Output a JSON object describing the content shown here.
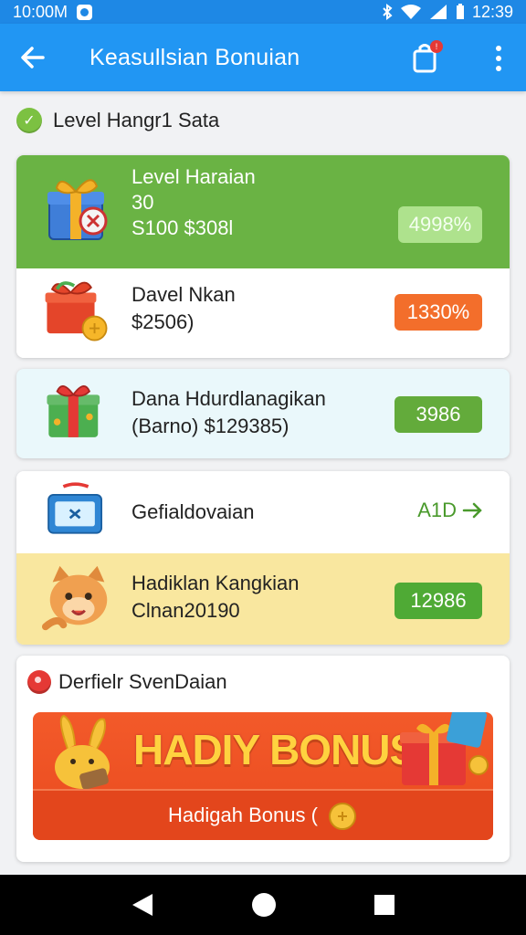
{
  "status_bar": {
    "time": "10:00M",
    "clock": "12:39"
  },
  "app_bar": {
    "title": "Keasullsian Bonuian",
    "cart_badge": "!"
  },
  "section": {
    "title": "Level Hangr1 Sata"
  },
  "cards": {
    "level": {
      "title": "Level Haraian",
      "subtitle": "30",
      "price": "S100 $308l",
      "pill": "4998%"
    },
    "davel": {
      "title": "Davel Nkan",
      "price": "$2506)",
      "pill": "1330%"
    },
    "dana": {
      "title": "Dana Hdurdlanagikan",
      "subtitle": "(Barno) $129385)",
      "pill": "3986"
    },
    "gefial": {
      "title": "Gefialdovaian",
      "link": "A1D"
    },
    "hadiklan": {
      "title": "Hadiklan Kangkian",
      "subtitle": "Clnan20190",
      "pill": "12986"
    }
  },
  "promo": {
    "title": "Derfielr SvenDaian",
    "banner_big": "HADIY BONUS",
    "banner_button": "Hadigah Bonus ("
  },
  "colors": {
    "primary": "#2196f3",
    "green": "#6ab344",
    "orange": "#f36e2b",
    "yellow": "#f9e79f"
  }
}
